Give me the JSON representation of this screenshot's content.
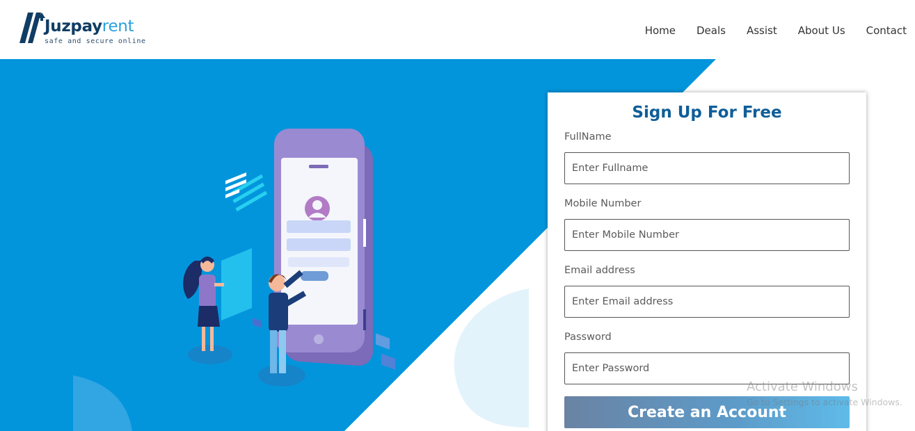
{
  "brand": {
    "name_part1": "Juzpay",
    "name_part2": "rent",
    "tagline": "safe and secure online"
  },
  "nav": {
    "items": [
      "Home",
      "Deals",
      "Assist",
      "About Us",
      "Contact"
    ]
  },
  "signup": {
    "title": "Sign Up For Free",
    "fields": [
      {
        "label": "FullName",
        "placeholder": "Enter Fullname"
      },
      {
        "label": "Mobile Number",
        "placeholder": "Enter Mobile Number"
      },
      {
        "label": "Email address",
        "placeholder": "Enter Email address"
      },
      {
        "label": "Password",
        "placeholder": "Enter Password"
      }
    ],
    "submit_label": "Create an Account"
  },
  "watermark": {
    "title": "Activate Windows",
    "subtitle": "Go to Settings to activate Windows."
  },
  "colors": {
    "hero_blue": "#0395dc",
    "brand_dark": "#103d63",
    "brand_light": "#2aa0dc",
    "title_blue": "#0f5e99"
  },
  "icons": {
    "logo_mark": "slash-house-logo",
    "illustration": "phone-login-illustration"
  }
}
